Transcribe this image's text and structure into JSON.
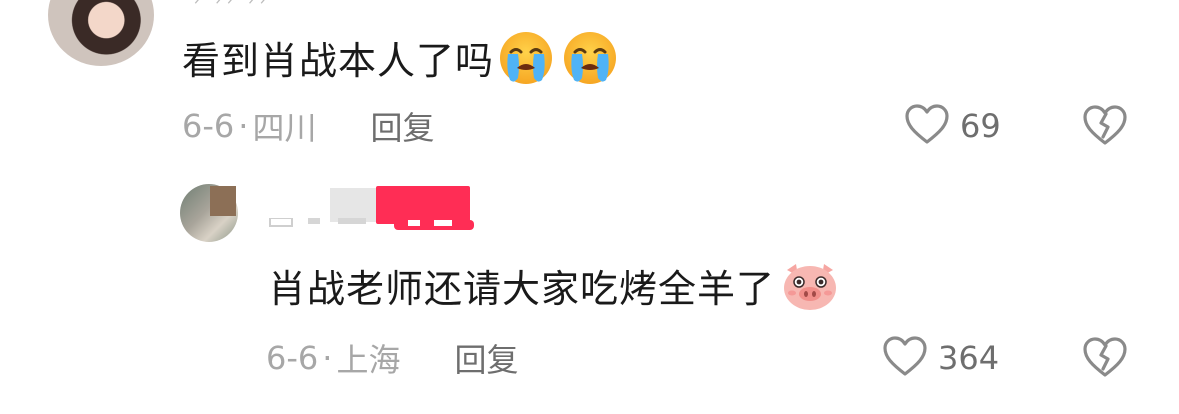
{
  "comments": [
    {
      "text": "看到肖战本人了吗",
      "emojis": [
        "loudly-crying-face-icon",
        "loudly-crying-face-icon"
      ],
      "date": "6-6",
      "separator": "·",
      "location": "四川",
      "reply_label": "回复",
      "likes": "69"
    },
    {
      "text": "肖战老师还请大家吃烤全羊了",
      "emojis": [
        "pig-face-icon"
      ],
      "date": "6-6",
      "separator": "·",
      "location": "上海",
      "reply_label": "回复",
      "likes": "364"
    }
  ],
  "colors": {
    "text": "#1a1a1a",
    "meta": "#a7a7a7",
    "secondary": "#6e6e6e",
    "accent": "#ff2d55"
  }
}
